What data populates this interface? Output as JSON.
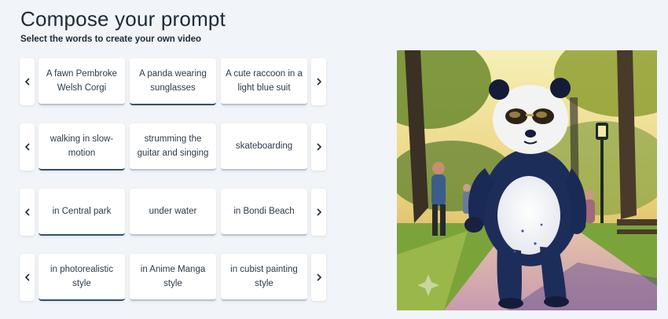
{
  "header": {
    "title": "Compose your prompt",
    "subtitle": "Select the words to create your own video"
  },
  "rows": [
    {
      "options": [
        "A fawn Pembroke Welsh Corgi",
        "A panda wearing sunglasses",
        "A cute raccoon in a light blue suit"
      ],
      "selected": 1
    },
    {
      "options": [
        "walking in slow-motion",
        "strumming the guitar and singing",
        "skateboarding"
      ],
      "selected": 0
    },
    {
      "options": [
        "in Central park",
        "under water",
        "in Bondi Beach"
      ],
      "selected": 0
    },
    {
      "options": [
        "in photorealistic style",
        "in Anime Manga style",
        "in cubist painting style"
      ],
      "selected": 0
    }
  ],
  "icons": {
    "prev": "chevron-left-icon",
    "next": "chevron-right-icon"
  },
  "colors": {
    "background": "#f1f4f8",
    "card": "#ffffff",
    "selected_underline": "#35506b",
    "text": "#1c2b39"
  }
}
